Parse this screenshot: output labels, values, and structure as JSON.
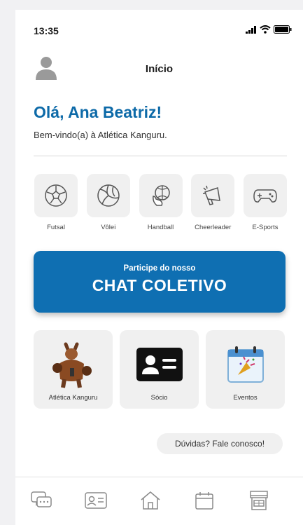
{
  "status": {
    "time": "13:35"
  },
  "header": {
    "title": "Início"
  },
  "greeting": "Olá, Ana Beatriz!",
  "welcome": "Bem-vindo(a) à Atlética Kanguru.",
  "sports": [
    {
      "label": "Futsal",
      "icon": "soccer-ball-icon"
    },
    {
      "label": "Vôlei",
      "icon": "volleyball-icon"
    },
    {
      "label": "Handball",
      "icon": "handball-icon"
    },
    {
      "label": "Cheerleader",
      "icon": "megaphone-icon"
    },
    {
      "label": "E-Sports",
      "icon": "gamepad-icon"
    }
  ],
  "chat": {
    "subtitle": "Participe do nosso",
    "title": "CHAT COLETIVO"
  },
  "cards": [
    {
      "label": "Atlética Kanguru",
      "icon": "kangaroo-mascot"
    },
    {
      "label": "Sócio",
      "icon": "id-card-icon"
    },
    {
      "label": "Eventos",
      "icon": "calendar-party-icon"
    }
  ],
  "help": "Dúvidas? Fale conosco!",
  "tabs": [
    "chat-icon",
    "member-card-icon",
    "home-icon",
    "calendar-icon",
    "store-icon"
  ],
  "colors": {
    "primary": "#0f6fb2",
    "greeting": "#0d6aa8",
    "tile": "#f0f0f0",
    "icon": "#8a8a8a"
  }
}
